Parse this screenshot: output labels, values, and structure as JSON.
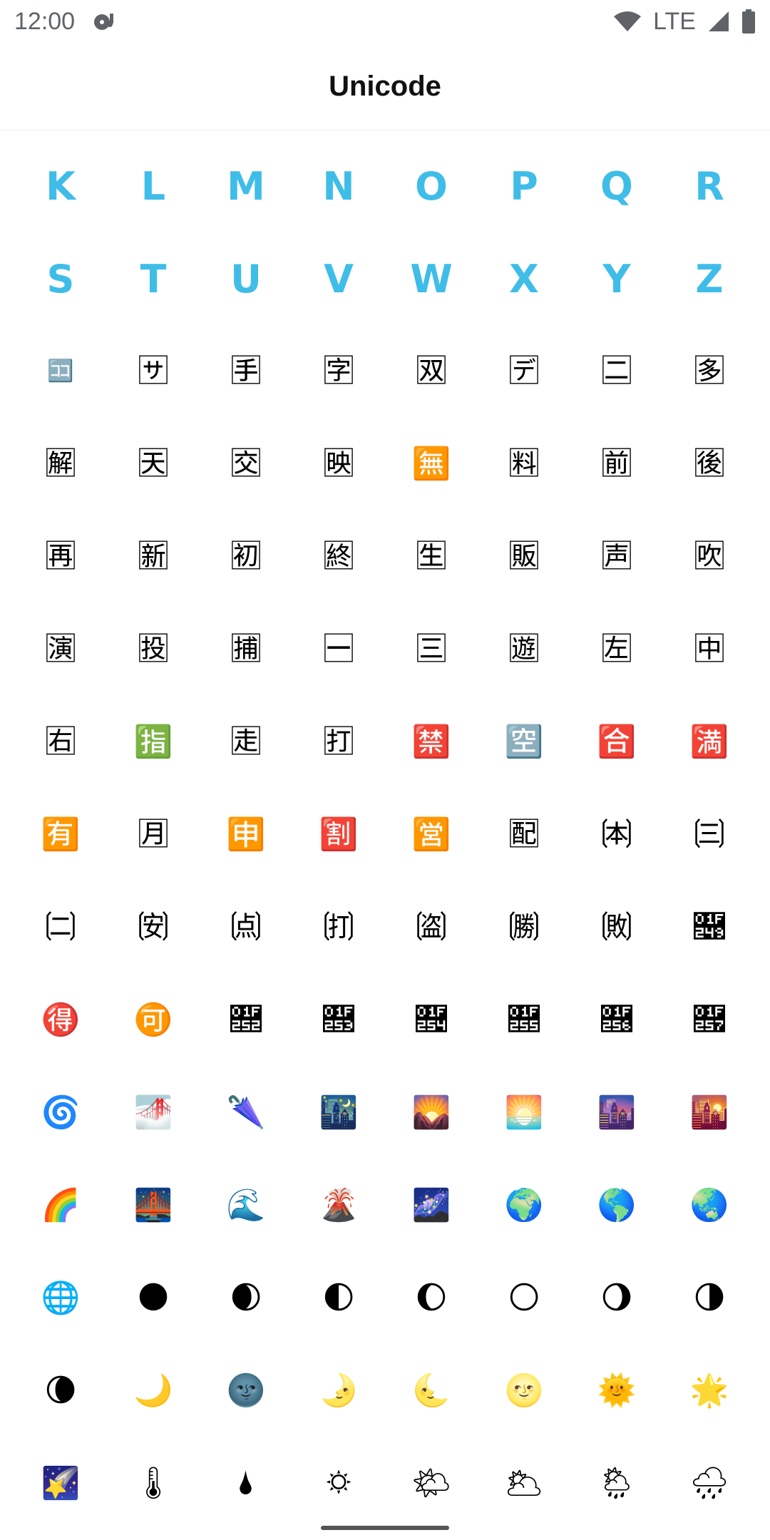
{
  "status_bar": {
    "time": "12:00",
    "network": "LTE"
  },
  "app_bar": {
    "title": "Unicode"
  },
  "grid": {
    "letters": [
      "K",
      "L",
      "M",
      "N",
      "O",
      "P",
      "Q",
      "R",
      "S",
      "T",
      "U",
      "V",
      "W",
      "X",
      "Y",
      "Z"
    ],
    "glyphs": [
      "🈁",
      "🈂",
      "🈐",
      "🈑",
      "🈒",
      "🈓",
      "🈔",
      "🈕",
      "🈖",
      "🈗",
      "🈘",
      "🈙",
      "🈚",
      "🈛",
      "🈜",
      "🈝",
      "🈞",
      "🈟",
      "🈠",
      "🈡",
      "🈢",
      "🈣",
      "🈤",
      "🈥",
      "🈦",
      "🈧",
      "🈨",
      "🈩",
      "🈪",
      "🈫",
      "🈬",
      "🈭",
      "🈮",
      "🈯",
      "🈰",
      "🈱",
      "🈲",
      "🈳",
      "🈴",
      "🈵",
      "🈶",
      "🈷",
      "🈸",
      "🈹",
      "🈺",
      "🈻",
      "🉀",
      "🉁",
      "🉂",
      "🉃",
      "🉄",
      "🉅",
      "🉆",
      "🉇",
      "🉈",
      "🉉",
      "🉐",
      "🉑",
      "🉒",
      "🉓",
      "🉔",
      "🉕",
      "🉖",
      "🉗",
      "🌀",
      "🌁",
      "🌂",
      "🌃",
      "🌄",
      "🌅",
      "🌆",
      "🌇",
      "🌈",
      "🌉",
      "🌊",
      "🌋",
      "🌌",
      "🌍",
      "🌎",
      "🌏",
      "🌐",
      "🌑",
      "🌒",
      "🌓",
      "🌔",
      "🌕",
      "🌖",
      "🌗",
      "🌘",
      "🌙",
      "🌚",
      "🌛",
      "🌜",
      "🌝",
      "🌞",
      "🌟",
      "🌠",
      "🌡",
      "🌢",
      "🌣",
      "🌤",
      "🌥",
      "🌦",
      "🌧"
    ]
  }
}
